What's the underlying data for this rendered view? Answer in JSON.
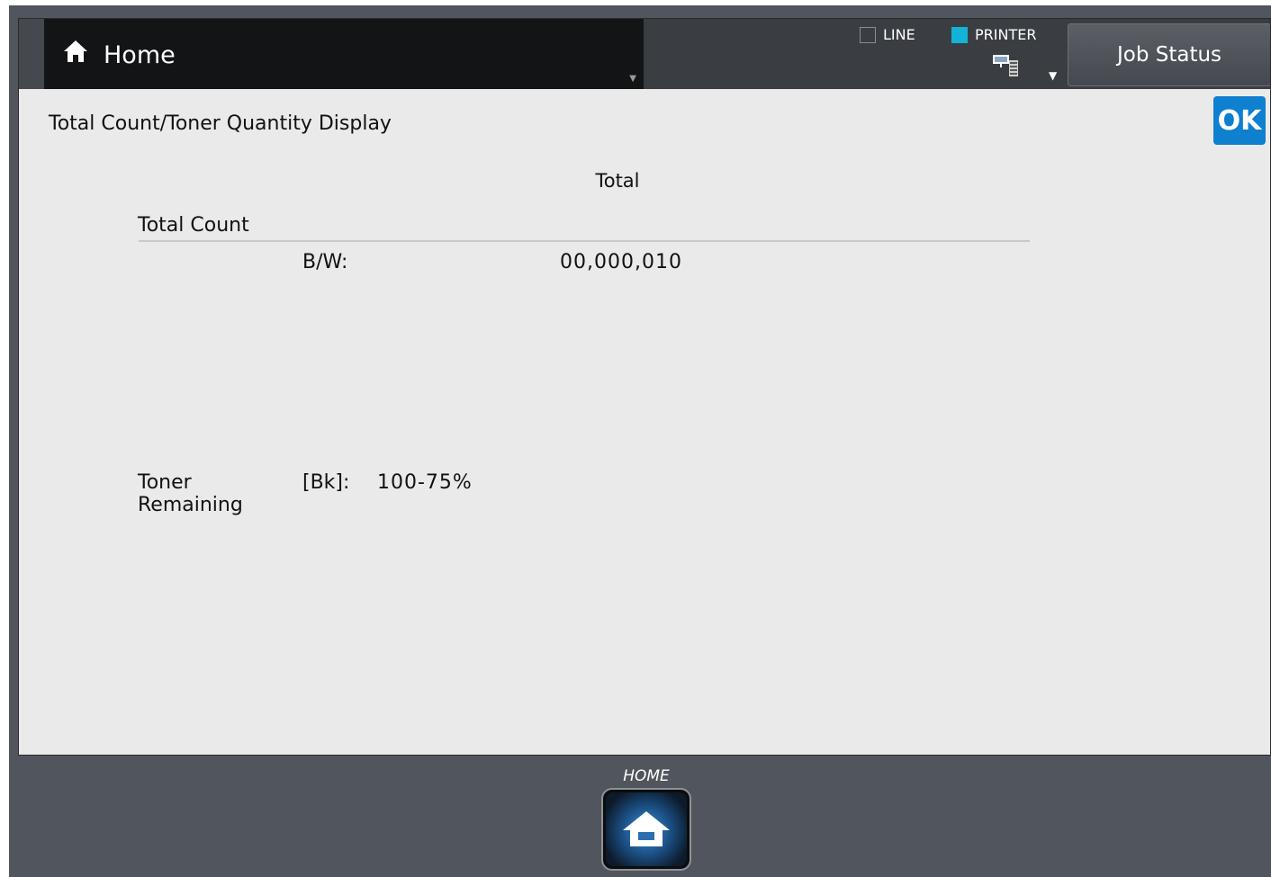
{
  "header": {
    "home_title": "Home",
    "line_label": "LINE",
    "printer_label": "PRINTER",
    "job_status_label": "Job Status",
    "printer_indicator_color": "#13b3d8"
  },
  "page": {
    "title": "Total Count/Toner Quantity Display",
    "ok_label": "OK",
    "column_header": "Total",
    "total_count": {
      "label": "Total Count",
      "rows": [
        {
          "label": "B/W:",
          "value": "00,000,010"
        }
      ]
    },
    "toner": {
      "label": "Toner Remaining",
      "color_label": "[Bk]:",
      "value": "100-75%"
    }
  },
  "bottom": {
    "home_key_label": "HOME"
  },
  "colors": {
    "ok_button": "#0f7fd0",
    "screen_background": "#eaeaea",
    "header_background": "#131416"
  }
}
